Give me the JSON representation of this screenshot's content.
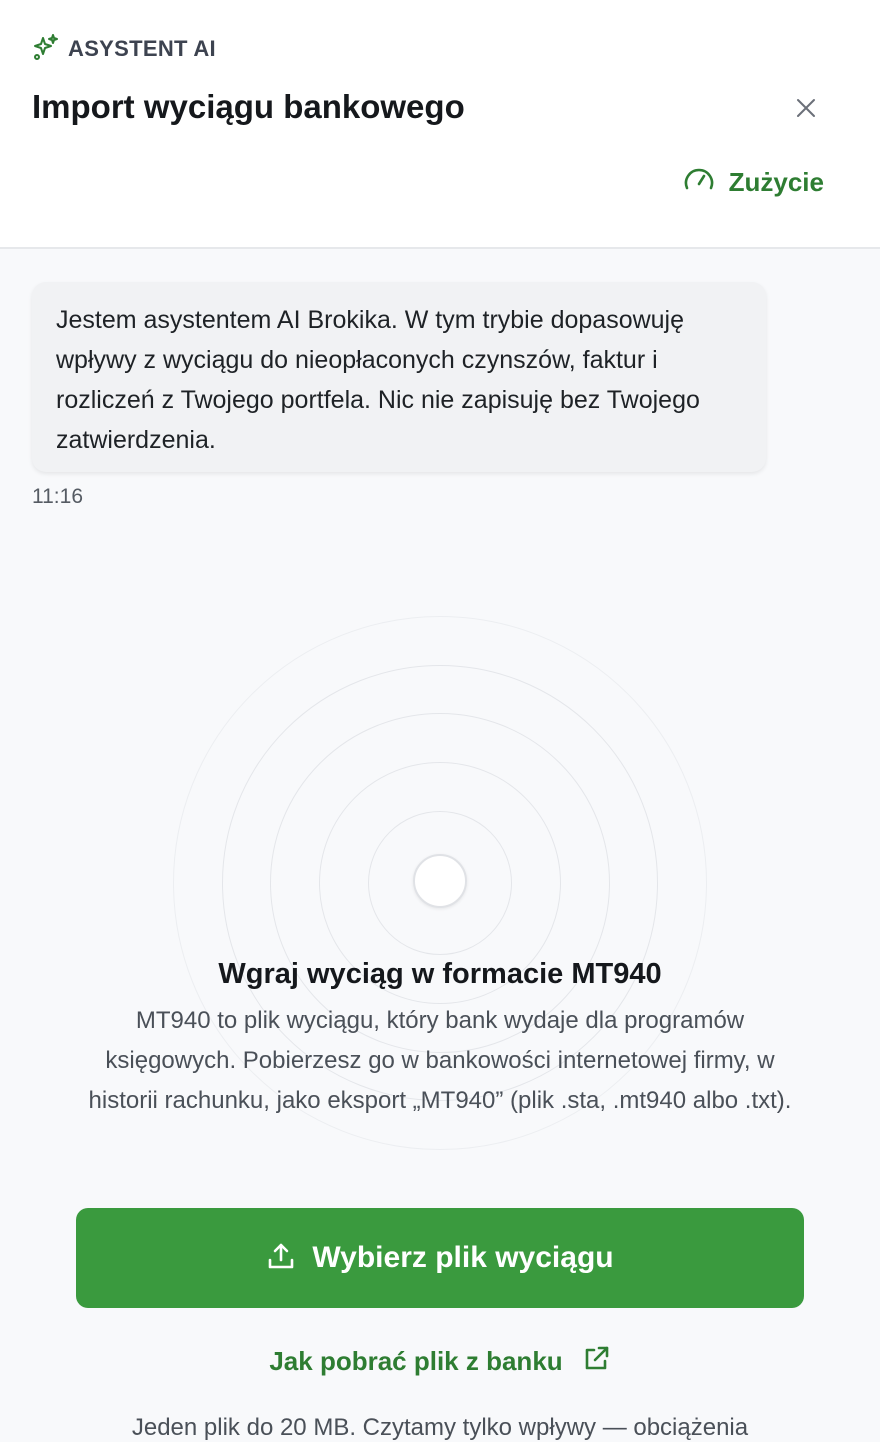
{
  "header": {
    "brand_label": "ASYSTENT AI",
    "title": "Import wyciągu bankowego",
    "usage_label": "Zużycie",
    "icons": {
      "brand": "sparkle-icon",
      "close": "close-icon",
      "usage": "gauge-icon"
    }
  },
  "chat": {
    "message": "Jestem asystentem AI Brokika. W tym trybie dopasowuję wpływy z wyciągu do nieopłaconych czynszów, faktur i rozliczeń z Twojego portfela. Nic nie zapisuję bez Twojego zatwierdzenia.",
    "timestamp": "11:16"
  },
  "upload": {
    "title": "Wgraj wyciąg w formacie MT940",
    "description": "MT940 to plik wyciągu, który bank wydaje dla programów księgowych. Pobierzesz go w bankowości internetowej firmy, w historii rachunku, jako eksport „MT940” (plik .sta, .mt940 albo .txt).",
    "button_label": "Wybierz plik wyciągu",
    "help_link_label": "Jak pobrać plik z banku",
    "footnote": "Jeden plik do 20 MB. Czytamy tylko wpływy — obciążenia"
  },
  "colors": {
    "accent": "#3a9a3e",
    "accent_text": "#2e7d32",
    "background": "#f8f9fb"
  }
}
